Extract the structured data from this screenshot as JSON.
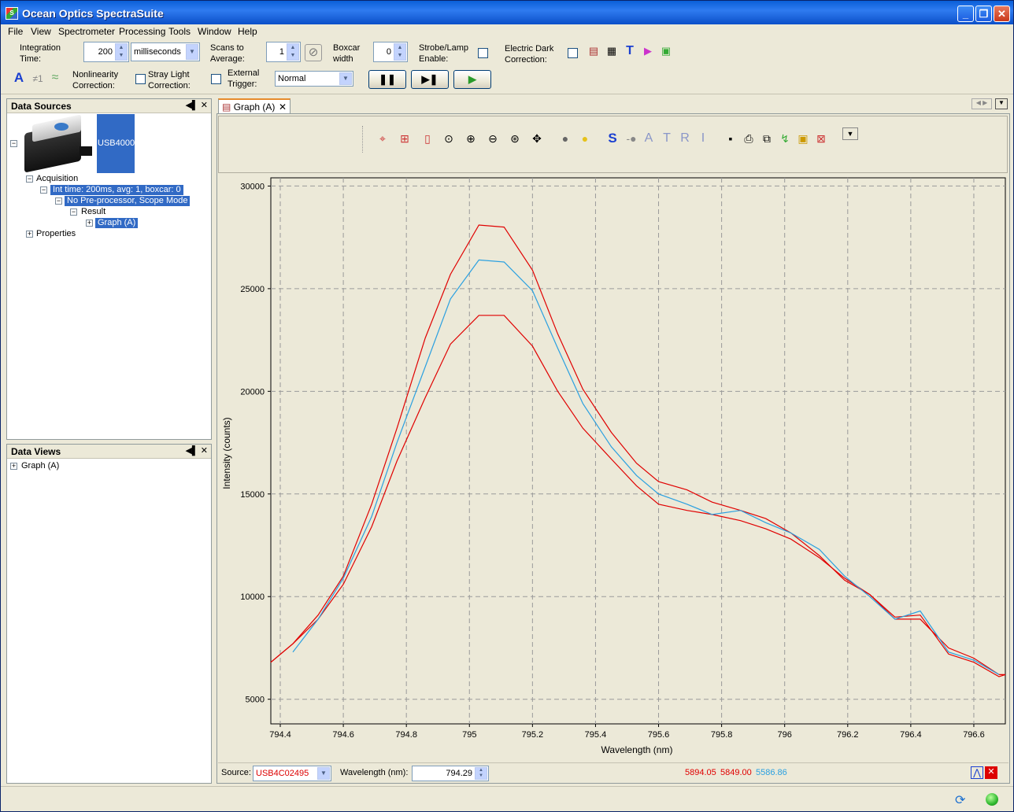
{
  "window": {
    "title": "Ocean Optics SpectraSuite",
    "app_icon": "spectrasuite-logo-icon"
  },
  "menu": [
    "File",
    "View",
    "Spectrometer",
    "Processing",
    "Tools",
    "Window",
    "Help"
  ],
  "toolbar": {
    "integration_label_1": "Integration",
    "integration_label_2": "Time:",
    "integration_value": "200",
    "integration_unit": "milliseconds",
    "scans_label_1": "Scans to",
    "scans_label_2": "Average:",
    "scans_value": "1",
    "boxcar_label_1": "Boxcar",
    "boxcar_label_2": "width",
    "boxcar_value": "0",
    "strobe_label_1": "Strobe/Lamp",
    "strobe_label_2": "Enable:",
    "dark_label_1": "Electric Dark",
    "dark_label_2": "Correction:",
    "nonlin_label_1": "Nonlinearity",
    "nonlin_label_2": "Correction:",
    "stray_label_1": "Stray Light",
    "stray_label_2": "Correction:",
    "trigger_label_1": "External",
    "trigger_label_2": "Trigger:",
    "trigger_value": "Normal",
    "mode_a": "A",
    "mode_ne1": "≠1"
  },
  "data_sources": {
    "title": "Data Sources",
    "device": "USB4000",
    "acquisition": "Acquisition",
    "acq_detail": "Int time: 200ms, avg: 1, boxcar: 0",
    "processor": "No Pre-processor, Scope Mode",
    "result": "Result",
    "graph": "Graph (A)",
    "properties": "Properties"
  },
  "data_views": {
    "title": "Data Views",
    "graph": "Graph (A)"
  },
  "graph_tab": {
    "label": "Graph (A)"
  },
  "graph_tool_letters": [
    "S",
    "A",
    "T",
    "R",
    "I"
  ],
  "bottom_bar": {
    "source_label": "Source:",
    "source_value": "USB4C02495",
    "wavelength_label": "Wavelength (nm):",
    "wavelength_value": "794.29",
    "readout_1": "5894.05",
    "readout_2": "5849.00",
    "readout_3": "5586.86",
    "readout_colors": [
      "#e00000",
      "#e00000",
      "#2aa0e0"
    ]
  },
  "chart_data": {
    "type": "line",
    "xlabel": "Wavelength (nm)",
    "ylabel": "Intensity (counts)",
    "xlim": [
      794.37,
      796.7
    ],
    "ylim": [
      3800,
      30400
    ],
    "xticks": [
      794.4,
      794.6,
      794.8,
      795,
      795.2,
      795.4,
      795.6,
      795.8,
      796,
      796.2,
      796.4,
      796.6
    ],
    "xtick_labels": [
      "794.4",
      "794.6",
      "794.8",
      "795",
      "795.2",
      "795.4",
      "795.6",
      "795.8",
      "796",
      "796.2",
      "796.4",
      "796.6"
    ],
    "yticks": [
      5000,
      10000,
      15000,
      20000,
      25000,
      30000
    ],
    "ytick_labels": [
      "5000",
      "10000",
      "15000",
      "20000",
      "25000",
      "30000"
    ],
    "grid": true,
    "series": [
      {
        "color": "#e00000",
        "x": [
          794.37,
          794.44,
          794.52,
          794.6,
          794.69,
          794.77,
          794.86,
          794.94,
          795.03,
          795.11,
          795.2,
          795.28,
          795.36,
          795.45,
          795.53,
          795.6,
          795.69,
          795.77,
          795.86,
          795.94,
          796.02,
          796.11,
          796.19,
          796.27,
          796.35,
          796.43,
          796.52,
          796.6,
          796.68,
          796.7
        ],
        "y": [
          6800,
          7700,
          9100,
          11000,
          14500,
          18200,
          22600,
          25700,
          28100,
          28000,
          25900,
          22800,
          20100,
          18000,
          16500,
          15600,
          15200,
          14600,
          14200,
          13800,
          13100,
          12000,
          10800,
          10100,
          8900,
          8900,
          7500,
          7000,
          6200,
          6200
        ]
      },
      {
        "color": "#e00000",
        "x": [
          794.37,
          794.44,
          794.52,
          794.6,
          794.69,
          794.77,
          794.86,
          794.94,
          795.03,
          795.11,
          795.2,
          795.28,
          795.36,
          795.45,
          795.53,
          795.6,
          795.69,
          795.77,
          795.86,
          795.94,
          796.02,
          796.11,
          796.19,
          796.27,
          796.35,
          796.43,
          796.52,
          796.6,
          796.68,
          796.7
        ],
        "y": [
          6800,
          7700,
          8900,
          10600,
          13400,
          16600,
          19700,
          22300,
          23700,
          23700,
          22200,
          20000,
          18200,
          16700,
          15400,
          14500,
          14200,
          14000,
          13700,
          13300,
          12800,
          11900,
          10900,
          10100,
          9000,
          9100,
          7200,
          6800,
          6100,
          6200
        ]
      },
      {
        "color": "#2aa0e0",
        "x": [
          794.44,
          794.52,
          794.6,
          794.69,
          794.77,
          794.86,
          794.94,
          795.03,
          795.11,
          795.2,
          795.28,
          795.36,
          795.45,
          795.53,
          795.6,
          795.69,
          795.77,
          795.86,
          795.94,
          796.02,
          796.11,
          796.19,
          796.27,
          796.35,
          796.43,
          796.52,
          796.6,
          796.68
        ],
        "y": [
          7300,
          8900,
          10900,
          13900,
          17500,
          21200,
          24500,
          26400,
          26300,
          24900,
          22100,
          19400,
          17300,
          15900,
          15000,
          14500,
          14000,
          14200,
          13600,
          13100,
          12300,
          11000,
          10000,
          8900,
          9300,
          7300,
          6900,
          6200
        ]
      }
    ]
  }
}
